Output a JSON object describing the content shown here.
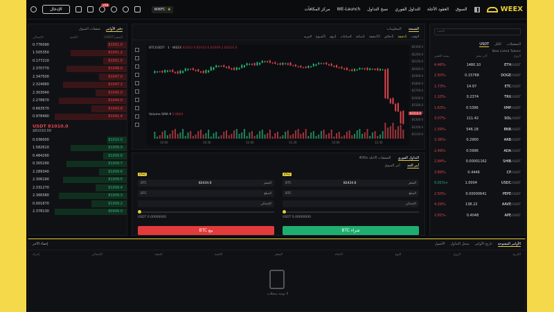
{
  "brand": {
    "name": "WEEX",
    "accent": "#e9cf35"
  },
  "nav": {
    "items": [
      "السوق",
      "العقود الآجلة",
      "التداول الفوري",
      "نسخ التداول",
      "WE-Launch",
      "مركز المكافآت"
    ],
    "promo": "WWFC",
    "notif_badge": "+99",
    "login": "الإدخال"
  },
  "orderbook": {
    "tabs": [
      "دفتر الأوامر",
      "صفقات السوق"
    ],
    "headers": [
      "السعر(USDT)",
      "الكمية",
      "الإجمالي"
    ],
    "asks": [
      {
        "price": "81051.0",
        "amount": "0.776090"
      },
      {
        "price": "81051.2",
        "amount": "1.505350"
      },
      {
        "price": "81051.5",
        "amount": "0.177210"
      },
      {
        "price": "81048.0",
        "amount": "2.370770"
      },
      {
        "price": "81047.0",
        "amount": "2.347500"
      },
      {
        "price": "81047.2",
        "amount": "2.324060"
      },
      {
        "price": "81045.0",
        "amount": "2.303040"
      },
      {
        "price": "81044.0",
        "amount": "2.278670"
      },
      {
        "price": "81043.8",
        "amount": "0.663570"
      },
      {
        "price": "81041.4",
        "amount": "0.978490"
      }
    ],
    "last_price": "USDT 81010.0",
    "last_sub": "$81010.00",
    "bids": [
      {
        "price": "81010.0",
        "amount": "0.036000"
      },
      {
        "price": "81009.9",
        "amount": "1.582610"
      },
      {
        "price": "81009.8",
        "amount": "0.484290"
      },
      {
        "price": "81009.7",
        "amount": "0.305290"
      },
      {
        "price": "81009.6",
        "amount": "2.289340"
      },
      {
        "price": "81009.5",
        "amount": "2.306190"
      },
      {
        "price": "81009.4",
        "amount": "2.331270"
      },
      {
        "price": "81009.3",
        "amount": "2.366580"
      },
      {
        "price": "81009.2",
        "amount": "0.001670"
      },
      {
        "price": "80999.0",
        "amount": "2.378130"
      }
    ]
  },
  "chart": {
    "tabs": [
      "الشمعة",
      "المعلومات"
    ],
    "intervals": [
      "الوقت",
      "1دقيقة",
      "5دقائق",
      "15دقيقة",
      "1ساعة",
      "4ساعات",
      "1يوم",
      "1أسبوع",
      "المزيد"
    ],
    "pair_label": "BTC/USDT · 1 · WEEX",
    "ohlc": "81010.0 81010.0 81009.2 81010.0",
    "vol_label": "Volume SMA 9",
    "vol_value": "5.8804",
    "price_ticks": [
      "82300.0",
      "82200.0",
      "82100.0",
      "82000.0",
      "81900.0",
      "81800.0",
      "81700.0",
      "81600.0",
      "81500.0",
      "81400.0",
      "81300.0",
      "81200.0",
      "81100.0"
    ],
    "last_tag": "81010.0",
    "time_ticks": [
      "10:00",
      "10:30",
      "11:00",
      "11:30",
      "12:00",
      "12:30"
    ],
    "series": [
      82000,
      82030,
      82010,
      82050,
      82020,
      81990,
      82040,
      82080,
      82060,
      82030,
      82000,
      82050,
      82110,
      82140,
      82120,
      82090,
      82060,
      82100,
      82150,
      82180,
      82150,
      82200,
      82230,
      82200,
      82180,
      82160,
      82190,
      82150,
      82130,
      82110,
      82100,
      82130,
      82170,
      82190,
      82170,
      82140,
      82110,
      82090,
      82060,
      82040,
      82070,
      82090,
      82060,
      82080,
      82050,
      82070,
      81500,
      81400,
      81250,
      81010
    ]
  },
  "trade": {
    "title": "التداول الفوري",
    "leverage": "الصفقات الآجلة 400x",
    "tabs": [
      "أمر الحد",
      "أمر السوق"
    ],
    "price_label": "السعر",
    "price_value": "82434.6",
    "amount_label": "المبلغ",
    "unit": "BTC",
    "total_label": "الإجمالي",
    "avail": "USDT 0.00000000",
    "buy": "شراء BTC",
    "sell": "بيع BTC",
    "deposit": "إيداع"
  },
  "markets": {
    "search": "البحث",
    "tabs": [
      "المفضلات",
      "الكل",
      "USDT"
    ],
    "sub": "New Listed Tokens",
    "headers": [
      "الزوج",
      "آخر سعر",
      "نسبة التغيير"
    ],
    "rows": [
      {
        "base": "ETH",
        "quote": "/USDT",
        "price": "1480.10",
        "change": "-4.46%"
      },
      {
        "base": "DOGE",
        "quote": "/USDT",
        "price": "0.15768",
        "change": "-2.50%"
      },
      {
        "base": "ETC",
        "quote": "/USDT",
        "price": "14.97",
        "change": "-1.73%"
      },
      {
        "base": "TRX",
        "quote": "/USDT",
        "price": "0.2374",
        "change": "-1.10%"
      },
      {
        "base": "XMP",
        "quote": "/USDT",
        "price": "0.5396",
        "change": "-1.63%"
      },
      {
        "base": "SOL",
        "quote": "/USDT",
        "price": "111.42",
        "change": "-3.07%"
      },
      {
        "base": "BNB",
        "quote": "/USDT",
        "price": "546.18",
        "change": "-1.59%"
      },
      {
        "base": "ARB",
        "quote": "/USDT",
        "price": "0.2900",
        "change": "-3.36%"
      },
      {
        "base": "ADA",
        "quote": "/USDT",
        "price": "0.5996",
        "change": "-2.49%"
      },
      {
        "base": "SHIB",
        "quote": "/USDT",
        "price": "0.00001162",
        "change": "-2.84%"
      },
      {
        "base": "CP",
        "quote": "/USDT",
        "price": "0.4446",
        "change": "-3.89%"
      },
      {
        "base": "USDC",
        "quote": "/USDT",
        "price": "1.0004",
        "change": "+0.01%"
      },
      {
        "base": "PEPE",
        "quote": "/USDT",
        "price": "0.00000641",
        "change": "-2.50%"
      },
      {
        "base": "AAVE",
        "quote": "/USDT",
        "price": "138.22",
        "change": "-4.29%"
      },
      {
        "base": "APE",
        "quote": "/USDT",
        "price": "0.4048",
        "change": "-2.81%"
      }
    ]
  },
  "orders": {
    "tabs": [
      "الأوامر المفتوحة",
      "تاريخ الأوامر",
      "سجل التداول",
      "الأصول"
    ],
    "cols": [
      "التاريخ",
      "الزوج",
      "النوع",
      "الاتجاه",
      "السعر",
      "الكمية",
      "المنفذ",
      "الإجمالي",
      "إجراء"
    ],
    "hide": "إخفاء الآخر",
    "empty": "لا توجد سجلات"
  }
}
